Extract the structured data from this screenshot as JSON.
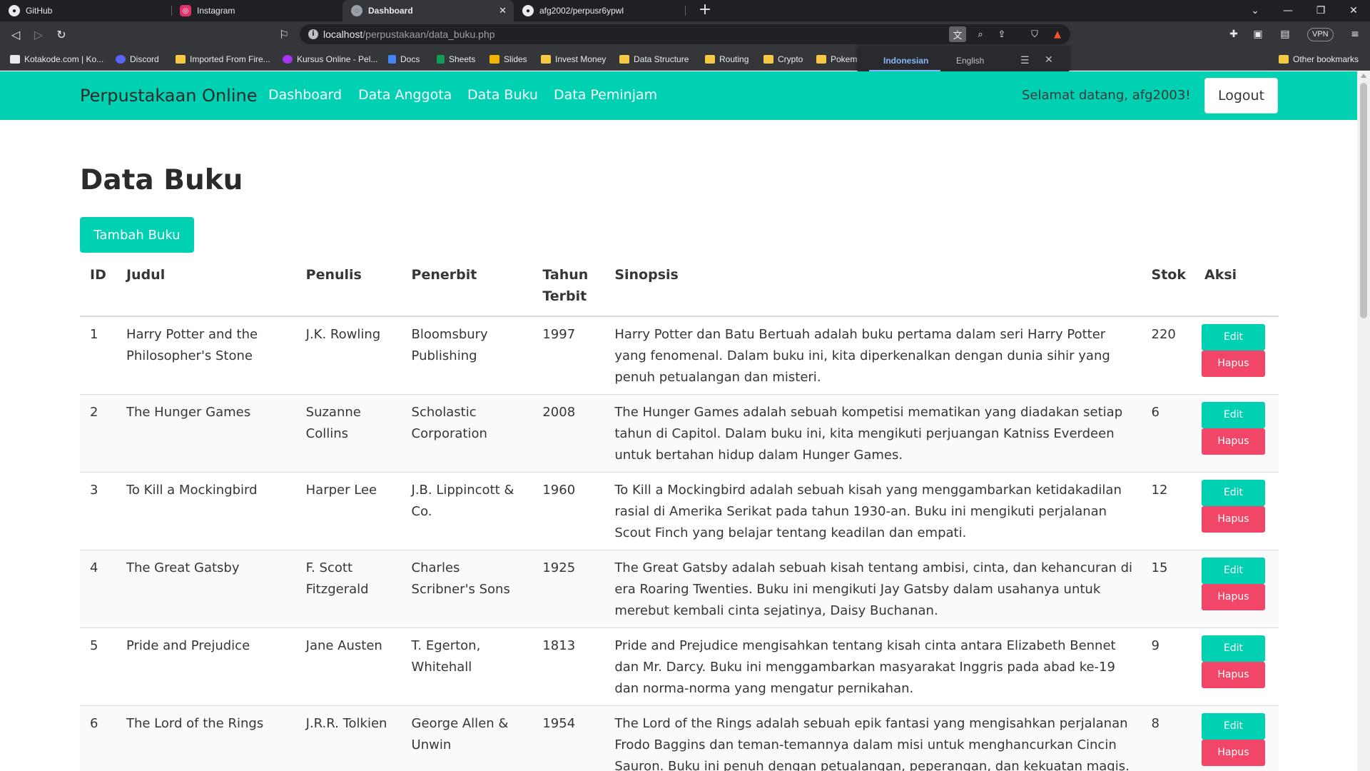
{
  "browser": {
    "tabs": [
      {
        "title": "GitHub",
        "active": false
      },
      {
        "title": "Instagram",
        "active": false
      },
      {
        "title": "Dashboard",
        "active": true
      },
      {
        "title": "afg2002/perpusr6ypwl",
        "active": false
      }
    ],
    "new_tab_symbol": "+",
    "url_host": "localhost",
    "url_path": "/perpustakaan/data_buku.php",
    "vpn_label": "VPN",
    "bookmarks": [
      {
        "label": "Kotakode.com | Ko...",
        "icon": "kotakode-icon"
      },
      {
        "label": "Discord",
        "icon": "discord-icon"
      },
      {
        "label": "Imported From Fire...",
        "icon": "folder-icon"
      },
      {
        "label": "Kursus Online - Pel...",
        "icon": "udemy-icon"
      },
      {
        "label": "Docs",
        "icon": "docs-icon"
      },
      {
        "label": "Sheets",
        "icon": "sheets-icon"
      },
      {
        "label": "Slides",
        "icon": "slides-icon"
      },
      {
        "label": "Invest Money",
        "icon": "folder-icon"
      },
      {
        "label": "Data Structure",
        "icon": "folder-icon"
      },
      {
        "label": "Routing",
        "icon": "folder-icon"
      },
      {
        "label": "Crypto",
        "icon": "folder-icon"
      },
      {
        "label": "Pokem",
        "icon": "folder-icon"
      }
    ],
    "other_bookmarks": "Other bookmarks",
    "translate": {
      "source_lang": "Indonesian",
      "target_lang": "English"
    }
  },
  "navbar": {
    "brand": "Perpustakaan Online",
    "links": [
      "Dashboard",
      "Data Anggota",
      "Data Buku",
      "Data Peminjam"
    ],
    "welcome": "Selamat datang, afg2003!",
    "logout": "Logout"
  },
  "main": {
    "title": "Data Buku",
    "add_button": "Tambah Buku",
    "columns": [
      "ID",
      "Judul",
      "Penulis",
      "Penerbit",
      "Tahun Terbit",
      "Sinopsis",
      "Stok",
      "Aksi"
    ],
    "edit_label": "Edit",
    "delete_label": "Hapus",
    "rows": [
      {
        "id": "1",
        "judul": "Harry Potter and the Philosopher's Stone",
        "penulis": "J.K. Rowling",
        "penerbit": "Bloomsbury Publishing",
        "tahun": "1997",
        "sinopsis": "Harry Potter dan Batu Bertuah adalah buku pertama dalam seri Harry Potter yang fenomenal. Dalam buku ini, kita diperkenalkan dengan dunia sihir yang penuh petualangan dan misteri.",
        "stok": "220"
      },
      {
        "id": "2",
        "judul": "The Hunger Games",
        "penulis": "Suzanne Collins",
        "penerbit": "Scholastic Corporation",
        "tahun": "2008",
        "sinopsis": "The Hunger Games adalah sebuah kompetisi mematikan yang diadakan setiap tahun di Capitol. Dalam buku ini, kita mengikuti perjuangan Katniss Everdeen untuk bertahan hidup dalam Hunger Games.",
        "stok": "6"
      },
      {
        "id": "3",
        "judul": "To Kill a Mockingbird",
        "penulis": "Harper Lee",
        "penerbit": "J.B. Lippincott & Co.",
        "tahun": "1960",
        "sinopsis": "To Kill a Mockingbird adalah sebuah kisah yang menggambarkan ketidakadilan rasial di Amerika Serikat pada tahun 1930-an. Buku ini mengikuti perjalanan Scout Finch yang belajar tentang keadilan dan empati.",
        "stok": "12"
      },
      {
        "id": "4",
        "judul": "The Great Gatsby",
        "penulis": "F. Scott Fitzgerald",
        "penerbit": "Charles Scribner's Sons",
        "tahun": "1925",
        "sinopsis": "The Great Gatsby adalah sebuah kisah tentang ambisi, cinta, dan kehancuran di era Roaring Twenties. Buku ini mengikuti Jay Gatsby dalam usahanya untuk merebut kembali cinta sejatinya, Daisy Buchanan.",
        "stok": "15"
      },
      {
        "id": "5",
        "judul": "Pride and Prejudice",
        "penulis": "Jane Austen",
        "penerbit": "T. Egerton, Whitehall",
        "tahun": "1813",
        "sinopsis": "Pride and Prejudice mengisahkan tentang kisah cinta antara Elizabeth Bennet dan Mr. Darcy. Buku ini menggambarkan masyarakat Inggris pada abad ke-19 dan norma-norma yang mengatur pernikahan.",
        "stok": "9"
      },
      {
        "id": "6",
        "judul": "The Lord of the Rings",
        "penulis": "J.R.R. Tolkien",
        "penerbit": "George Allen & Unwin",
        "tahun": "1954",
        "sinopsis": "The Lord of the Rings adalah sebuah epik fantasi yang mengisahkan perjalanan Frodo Baggins dan teman-temannya dalam misi untuk menghancurkan Cincin Sauron. Buku ini penuh dengan petualangan, peperangan, dan kekuatan magis.",
        "stok": "8"
      }
    ]
  },
  "colors": {
    "accent": "#00d1b2",
    "danger": "#f14668"
  }
}
